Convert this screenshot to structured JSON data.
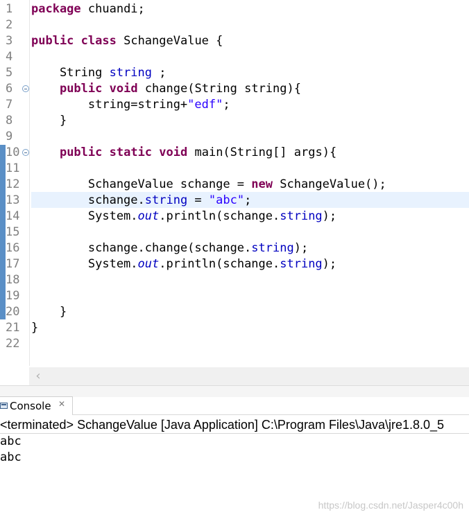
{
  "editor": {
    "line_numbers": [
      "1",
      "2",
      "3",
      "4",
      "5",
      "6",
      "7",
      "8",
      "9",
      "10",
      "11",
      "12",
      "13",
      "14",
      "15",
      "16",
      "17",
      "18",
      "19",
      "20",
      "21",
      "22"
    ],
    "code": {
      "l1_kw": "package",
      "l1_rest": " chuandi;",
      "l3_kw1": "public",
      "l3_kw2": "class",
      "l3_rest": " SchangeValue {",
      "l5_type": "    String ",
      "l5_field": "string",
      "l5_rest": " ;",
      "l6_indent": "    ",
      "l6_kw1": "public",
      "l6_kw2": "void",
      "l6_rest": " change(String string){",
      "l7_code": "        string=string+",
      "l7_str": "\"edf\"",
      "l7_end": ";",
      "l8_code": "    }",
      "l10_indent": "    ",
      "l10_kw1": "public",
      "l10_kw2": "static",
      "l10_kw3": "void",
      "l10_rest": " main(String[] args){",
      "l12_code": "        SchangeValue schange = ",
      "l12_kw": "new",
      "l12_rest": " SchangeValue();",
      "l13_code": "        schange.",
      "l13_field": "string",
      "l13_mid": " = ",
      "l13_str": "\"abc\"",
      "l13_end": ";",
      "l14_code": "        System.",
      "l14_static": "out",
      "l14_mid": ".println(schange.",
      "l14_field": "string",
      "l14_end": ");",
      "l16_code": "        schange.change(schange.",
      "l16_field": "string",
      "l16_end": ");",
      "l17_code": "        System.",
      "l17_static": "out",
      "l17_mid": ".println(schange.",
      "l17_field": "string",
      "l17_end": ");",
      "l20_code": "    }",
      "l21_code": "}"
    }
  },
  "console": {
    "tab_label": "Console",
    "close_glyph": "✕",
    "status": "<terminated> SchangeValue [Java Application] C:\\Program Files\\Java\\jre1.8.0_5",
    "output": [
      "abc",
      "abc"
    ]
  },
  "scrollbar": {
    "left_arrow": "‹"
  },
  "watermark": "https://blog.csdn.net/Jasper4c00h",
  "colors": {
    "keyword": "#7f0055",
    "field": "#0000c0",
    "string": "#2a00ff",
    "current_line": "#e8f2fe",
    "change_bar": "#5a8fc6"
  }
}
